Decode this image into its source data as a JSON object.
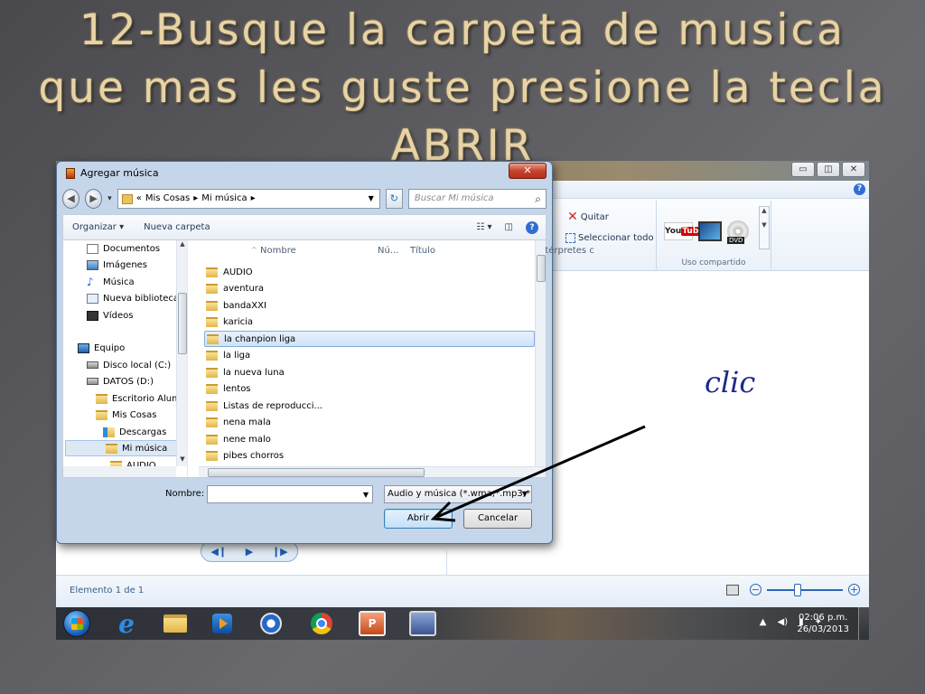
{
  "slide": {
    "title": "12-Busque la carpeta de musica que mas les guste presione la tecla ABRIR",
    "annotation": "clic"
  },
  "player": {
    "ribbon": {
      "remove_label": "Quitar",
      "select_all_label": "Seleccionar todo",
      "share_group_label": "Uso compartido",
      "youtube_label": "You",
      "youtube_badge": "Tube",
      "dvd_label": "DVD"
    },
    "status_text": "Elemento 1 de 1",
    "window_controls": [
      "▭",
      "◫",
      "✕"
    ]
  },
  "dialog": {
    "title": "Agregar música",
    "close_label": "✕",
    "breadcrumb": [
      "«",
      "Mis Cosas",
      "▸",
      "Mi música",
      "▸"
    ],
    "search_placeholder": "Buscar Mi música",
    "toolbar": {
      "organize_label": "Organizar ▾",
      "new_folder_label": "Nueva carpeta",
      "view_label": "☷ ▾",
      "preview_label": "◫"
    },
    "tree_items": [
      {
        "label": "Documentos",
        "icon": "doc"
      },
      {
        "label": "Imágenes",
        "icon": "pic"
      },
      {
        "label": "Música",
        "icon": "mus"
      },
      {
        "label": "Nueva biblioteca",
        "icon": "lib"
      },
      {
        "label": "Vídeos",
        "icon": "vid"
      },
      {
        "label": "Equipo",
        "icon": "pc"
      },
      {
        "label": "Disco local (C:)",
        "icon": "hdd"
      },
      {
        "label": "DATOS (D:)",
        "icon": "hdd"
      },
      {
        "label": "Escritorio Alum",
        "icon": "fold"
      },
      {
        "label": "Mis Cosas",
        "icon": "fold"
      },
      {
        "label": "Descargas",
        "icon": "dl"
      },
      {
        "label": "Mi música",
        "icon": "fold"
      },
      {
        "label": "AUDIO",
        "icon": "fold"
      }
    ],
    "columns": [
      "Nombre",
      "Nú...",
      "Título",
      "Intérpretes c"
    ],
    "files": [
      "AUDIO",
      "aventura",
      "bandaXXI",
      "karicia",
      "la chanpion liga",
      "la liga",
      "la nueva luna",
      "lentos",
      "Listas de reproducci...",
      "nena mala",
      "nene malo",
      "pibes chorros"
    ],
    "selected_file": "la chanpion liga",
    "name_label": "Nombre:",
    "name_value": "",
    "type_value": "Audio y música (*.wma;*.mp3;*",
    "open_button": "Abrir",
    "cancel_button": "Cancelar"
  },
  "taskbar": {
    "ie_label": "e",
    "ppt_label": "P",
    "clock_time": "02:06 p.m.",
    "clock_date": "26/03/2013",
    "tray_icons": [
      "▲",
      "◀)",
      "▮",
      "✦"
    ]
  }
}
